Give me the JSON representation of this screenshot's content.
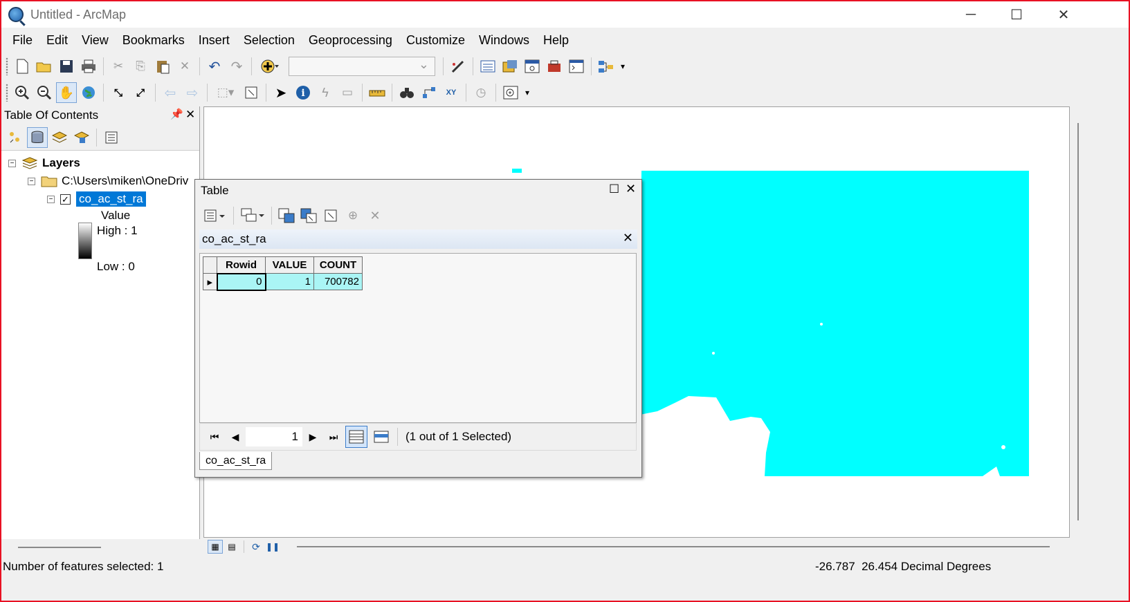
{
  "window": {
    "title": "Untitled - ArcMap"
  },
  "menu": [
    "File",
    "Edit",
    "View",
    "Bookmarks",
    "Insert",
    "Selection",
    "Geoprocessing",
    "Customize",
    "Windows",
    "Help"
  ],
  "toc": {
    "title": "Table Of Contents",
    "layers_label": "Layers",
    "folder_path": "C:\\Users\\miken\\OneDriv",
    "layer_name": "co_ac_st_ra",
    "legend_heading": "Value",
    "legend_high": "High : 1",
    "legend_low": "Low : 0"
  },
  "table_window": {
    "title": "Table",
    "table_name": "co_ac_st_ra",
    "columns": [
      "Rowid",
      "VALUE",
      "COUNT"
    ],
    "rows": [
      {
        "rowid": "0",
        "value": "1",
        "count": "700782"
      }
    ],
    "current_record": "1",
    "selection_text": "(1 out of 1 Selected)",
    "tab_label": "co_ac_st_ra"
  },
  "map": {
    "fill_color": "#00ffff"
  },
  "status": {
    "left": "Number of features selected: 1",
    "coords": "-26.787  26.454 Decimal Degrees"
  }
}
